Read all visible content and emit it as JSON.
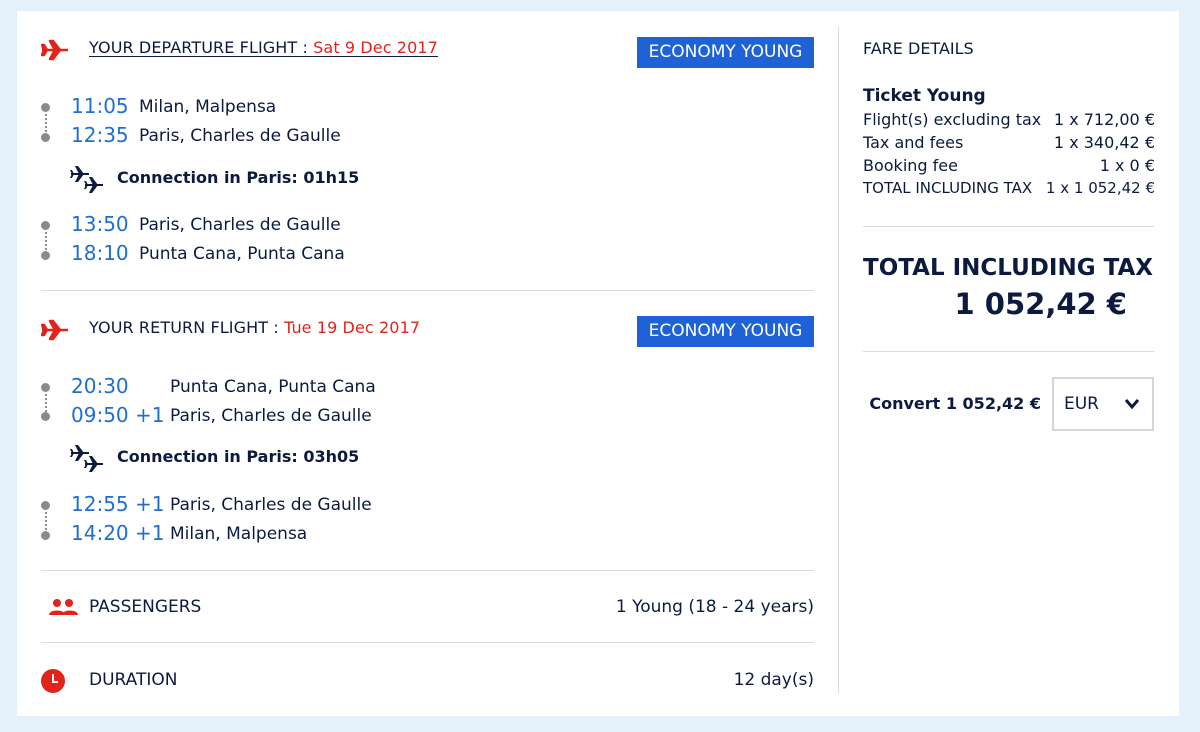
{
  "departure": {
    "title": "YOUR DEPARTURE FLIGHT : ",
    "date": "Sat 9 Dec 2017",
    "class_badge": "ECONOMY YOUNG",
    "segments": [
      {
        "dep_time": "11:05",
        "dep_place": "Milan, Malpensa",
        "arr_time": "12:35",
        "arr_place": "Paris, Charles de Gaulle"
      },
      {
        "dep_time": "13:50",
        "dep_place": "Paris, Charles de Gaulle",
        "arr_time": "18:10",
        "arr_place": "Punta Cana, Punta Cana"
      }
    ],
    "connection": "Connection in Paris: 01h15"
  },
  "return": {
    "title": "YOUR RETURN FLIGHT : ",
    "date": "Tue 19 Dec 2017",
    "class_badge": "ECONOMY YOUNG",
    "segments": [
      {
        "dep_time": "20:30",
        "dep_place": "Punta Cana, Punta Cana",
        "arr_time": "09:50 +1",
        "arr_place": "Paris, Charles de Gaulle"
      },
      {
        "dep_time": "12:55 +1",
        "dep_place": "Paris, Charles de Gaulle",
        "arr_time": "14:20 +1",
        "arr_place": "Milan, Malpensa"
      }
    ],
    "connection": "Connection in Paris: 03h05"
  },
  "passengers": {
    "label": "PASSENGERS",
    "value": "1 Young (18 - 24 years)"
  },
  "duration": {
    "label": "DURATION",
    "value": "12 day(s)"
  },
  "fare": {
    "heading": "FARE DETAILS",
    "ticket": "Ticket Young",
    "rows": [
      {
        "label": "Flight(s) excluding tax",
        "value": "1 x 712,00 €"
      },
      {
        "label": "Tax and fees",
        "value": "1 x 340,42 €"
      },
      {
        "label": "Booking fee",
        "value": "1 x 0 €"
      },
      {
        "label": "TOTAL INCLUDING TAX",
        "value": "1 x 1 052,42 €"
      }
    ],
    "total_label": "TOTAL INCLUDING TAX",
    "total_value": "1 052,42 €",
    "convert_label": "Convert 1 052,42 €",
    "currency": "EUR"
  },
  "icons": {
    "plane": "airplane-icon",
    "connection": "connecting-flights-icon",
    "passengers": "people-icon",
    "duration": "clock-icon"
  },
  "colors": {
    "accent_red": "#e0241b",
    "time_blue": "#1f6fd1",
    "badge_blue": "#1e62d6",
    "navy": "#0b1a3e"
  }
}
